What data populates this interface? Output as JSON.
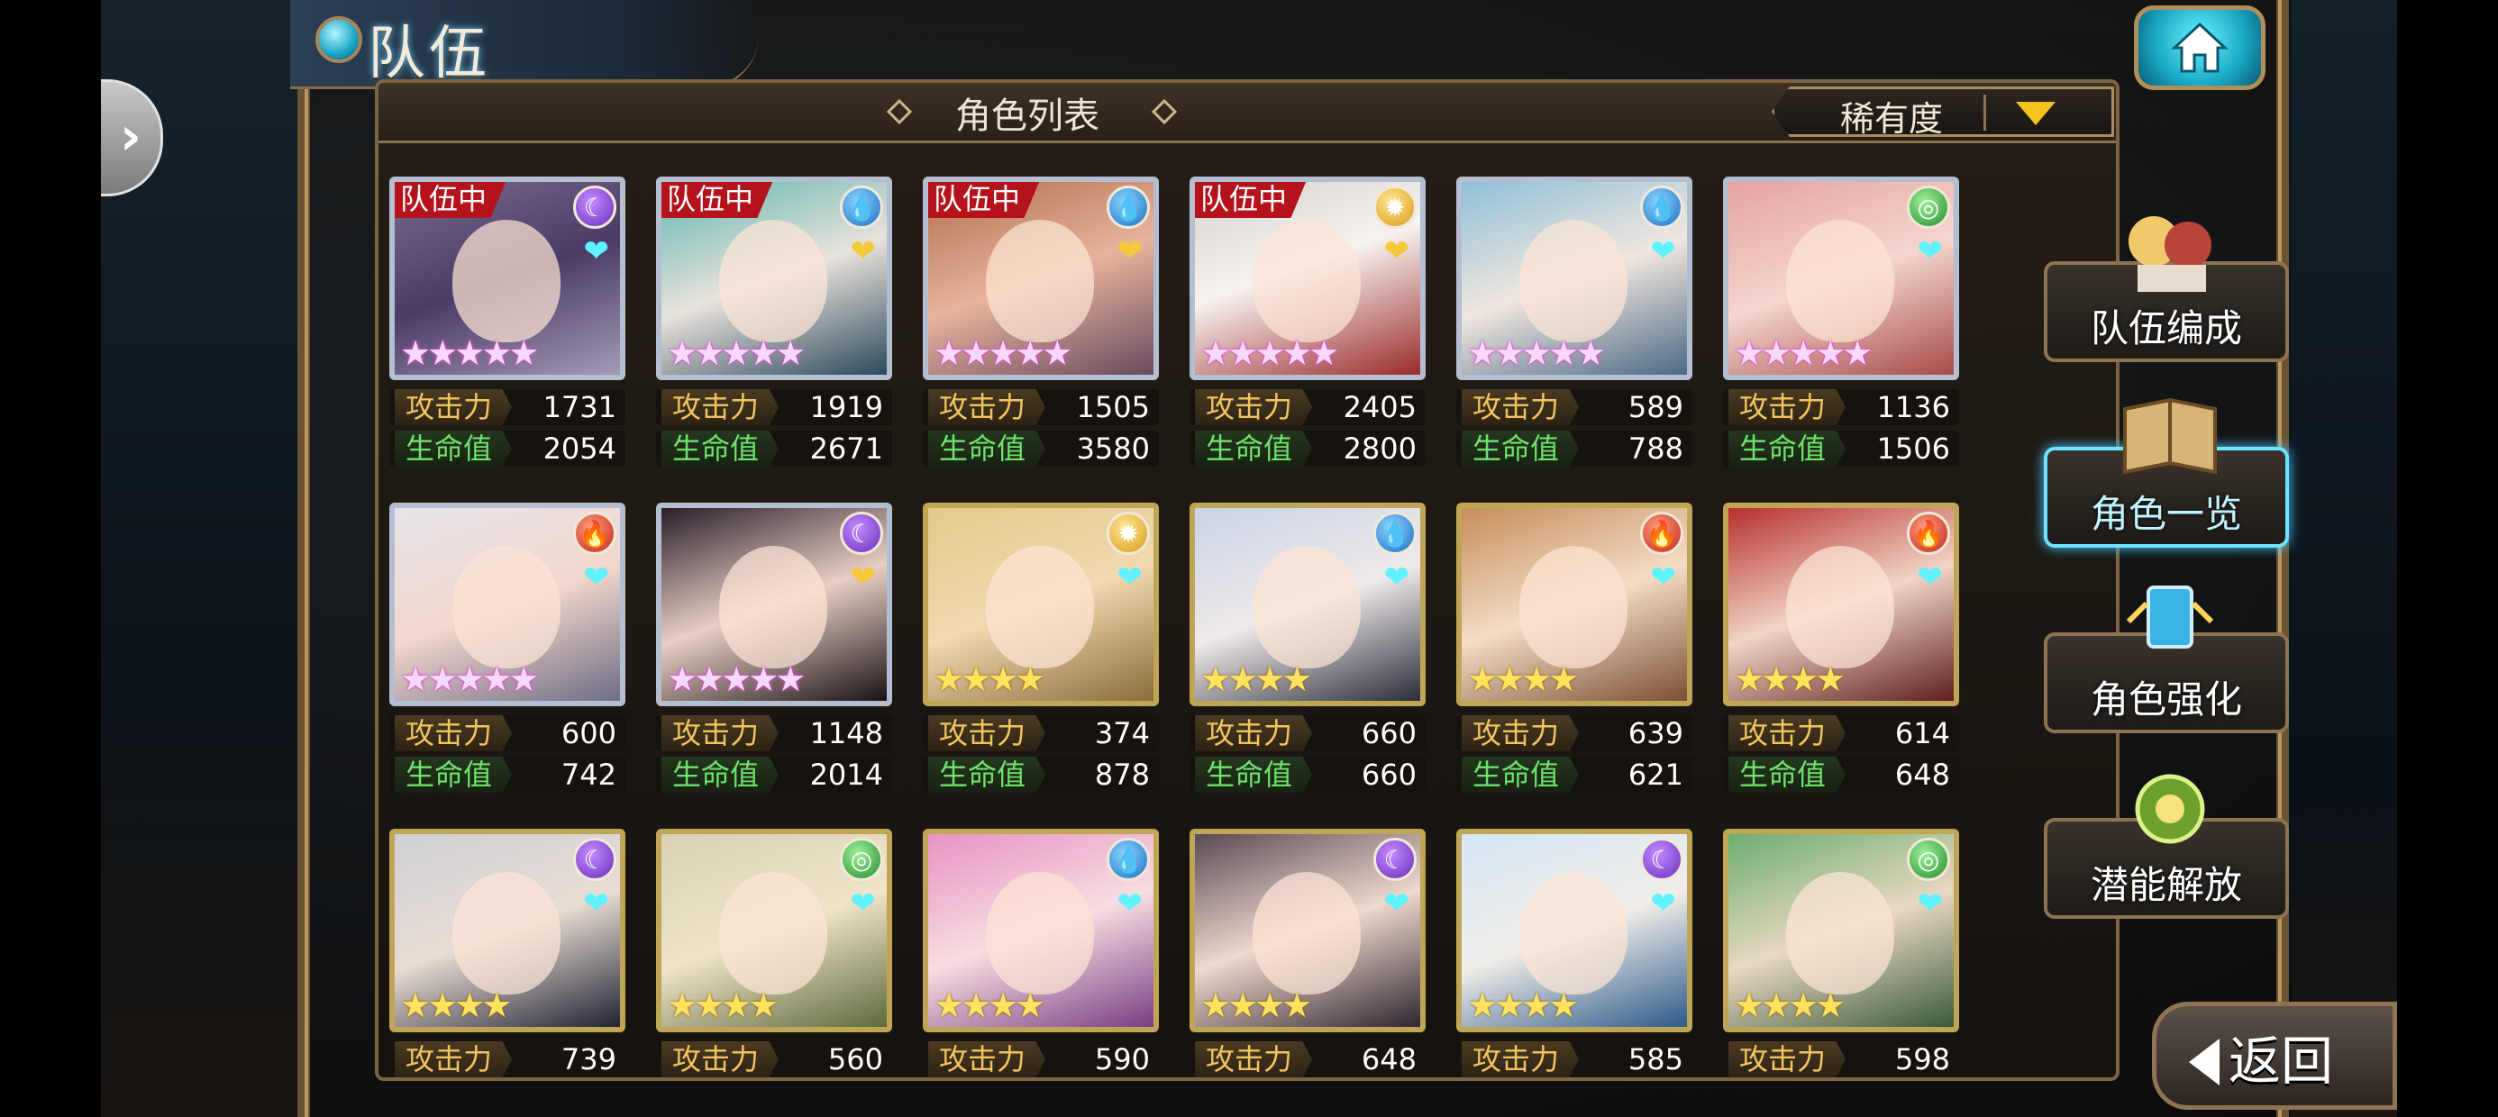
{
  "header": {
    "title": "队伍"
  },
  "panel": {
    "title": "角色列表",
    "sort_label": "稀有度"
  },
  "menu": [
    {
      "label": "队伍编成",
      "icon": "party-icon",
      "active": false
    },
    {
      "label": "角色一览",
      "icon": "book-icon",
      "active": true
    },
    {
      "label": "角色强化",
      "icon": "enhance-icon",
      "active": false
    },
    {
      "label": "潜能解放",
      "icon": "potential-icon",
      "active": false
    }
  ],
  "back_label": "返回",
  "stat_labels": {
    "attack": "攻击力",
    "hp": "生命值"
  },
  "party_badge": "队伍中",
  "colors": {
    "accent": "#6fe3ff",
    "attack": "#f3c45e",
    "hp": "#6ee36a",
    "party_badge": "#b5121b"
  },
  "characters": [
    {
      "in_party": true,
      "element": "dark",
      "heart": "cyan",
      "stars": 5,
      "attack": "1731",
      "hp": "2054"
    },
    {
      "in_party": true,
      "element": "water",
      "heart": "gold",
      "stars": 5,
      "attack": "1919",
      "hp": "2671"
    },
    {
      "in_party": true,
      "element": "water",
      "heart": "gold",
      "stars": 5,
      "attack": "1505",
      "hp": "3580"
    },
    {
      "in_party": true,
      "element": "light",
      "heart": "gold",
      "stars": 5,
      "attack": "2405",
      "hp": "2800"
    },
    {
      "in_party": false,
      "element": "water",
      "heart": "cyan",
      "stars": 5,
      "attack": "589",
      "hp": "788"
    },
    {
      "in_party": false,
      "element": "wind",
      "heart": "cyan",
      "stars": 5,
      "attack": "1136",
      "hp": "1506"
    },
    {
      "in_party": false,
      "element": "fire",
      "heart": "cyan",
      "stars": 5,
      "attack": "600",
      "hp": "742"
    },
    {
      "in_party": false,
      "element": "dark",
      "heart": "gold",
      "stars": 5,
      "attack": "1148",
      "hp": "2014"
    },
    {
      "in_party": false,
      "element": "light",
      "heart": "cyan",
      "stars": 4,
      "attack": "374",
      "hp": "878"
    },
    {
      "in_party": false,
      "element": "water",
      "heart": "cyan",
      "stars": 4,
      "attack": "660",
      "hp": "660"
    },
    {
      "in_party": false,
      "element": "fire",
      "heart": "cyan",
      "stars": 4,
      "attack": "639",
      "hp": "621"
    },
    {
      "in_party": false,
      "element": "fire",
      "heart": "cyan",
      "stars": 4,
      "attack": "614",
      "hp": "648"
    },
    {
      "in_party": false,
      "element": "dark",
      "heart": "cyan",
      "stars": 4,
      "attack": "739",
      "hp": ""
    },
    {
      "in_party": false,
      "element": "wind",
      "heart": "cyan",
      "stars": 4,
      "attack": "560",
      "hp": ""
    },
    {
      "in_party": false,
      "element": "water",
      "heart": "cyan",
      "stars": 4,
      "attack": "590",
      "hp": ""
    },
    {
      "in_party": false,
      "element": "dark",
      "heart": "cyan",
      "stars": 4,
      "attack": "648",
      "hp": ""
    },
    {
      "in_party": false,
      "element": "dark",
      "heart": "cyan",
      "stars": 4,
      "attack": "585",
      "hp": ""
    },
    {
      "in_party": false,
      "element": "wind",
      "heart": "cyan",
      "stars": 4,
      "attack": "598",
      "hp": ""
    }
  ]
}
